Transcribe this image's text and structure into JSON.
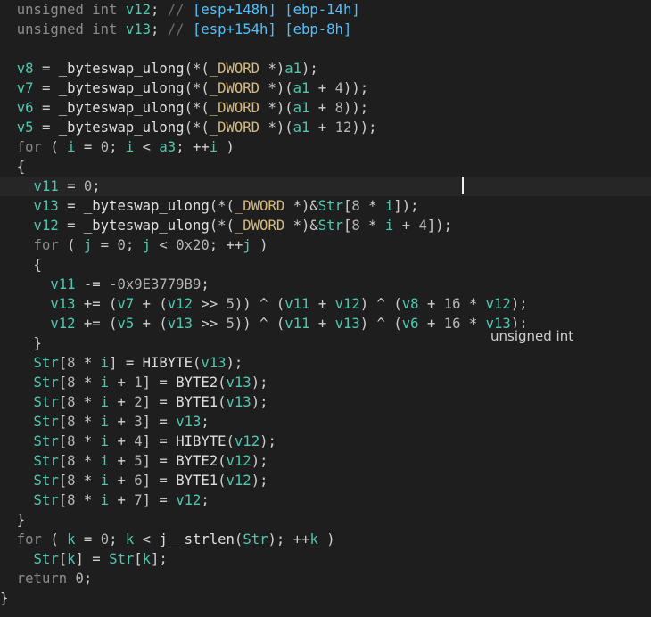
{
  "editor": {
    "lines": [
      [
        {
          "c": "kw",
          "t": "  unsigned int "
        },
        {
          "c": "var",
          "t": "v12"
        },
        {
          "c": "op",
          "t": "; "
        },
        {
          "c": "cm",
          "t": "// "
        },
        {
          "c": "cma",
          "t": "[esp+148h] [ebp-14h]"
        }
      ],
      [
        {
          "c": "kw",
          "t": "  unsigned int "
        },
        {
          "c": "var",
          "t": "v13"
        },
        {
          "c": "op",
          "t": "; "
        },
        {
          "c": "cm",
          "t": "// "
        },
        {
          "c": "cma",
          "t": "[esp+154h] [ebp-8h]"
        }
      ],
      [],
      [
        {
          "c": "var",
          "t": "  v8"
        },
        {
          "c": "op",
          "t": " = "
        },
        {
          "c": "fn",
          "t": "_byteswap_ulong"
        },
        {
          "c": "op",
          "t": "(*("
        },
        {
          "c": "ty",
          "t": "_DWORD"
        },
        {
          "c": "op",
          "t": " *)"
        },
        {
          "c": "var",
          "t": "a1"
        },
        {
          "c": "op",
          "t": ");"
        }
      ],
      [
        {
          "c": "var",
          "t": "  v7"
        },
        {
          "c": "op",
          "t": " = "
        },
        {
          "c": "fn",
          "t": "_byteswap_ulong"
        },
        {
          "c": "op",
          "t": "(*("
        },
        {
          "c": "ty",
          "t": "_DWORD"
        },
        {
          "c": "op",
          "t": " *)("
        },
        {
          "c": "var",
          "t": "a1"
        },
        {
          "c": "op",
          "t": " + "
        },
        {
          "c": "num",
          "t": "4"
        },
        {
          "c": "op",
          "t": "));"
        }
      ],
      [
        {
          "c": "var",
          "t": "  v6"
        },
        {
          "c": "op",
          "t": " = "
        },
        {
          "c": "fn",
          "t": "_byteswap_ulong"
        },
        {
          "c": "op",
          "t": "(*("
        },
        {
          "c": "ty",
          "t": "_DWORD"
        },
        {
          "c": "op",
          "t": " *)("
        },
        {
          "c": "var",
          "t": "a1"
        },
        {
          "c": "op",
          "t": " + "
        },
        {
          "c": "num",
          "t": "8"
        },
        {
          "c": "op",
          "t": "));"
        }
      ],
      [
        {
          "c": "var",
          "t": "  v5"
        },
        {
          "c": "op",
          "t": " = "
        },
        {
          "c": "fn",
          "t": "_byteswap_ulong"
        },
        {
          "c": "op",
          "t": "(*("
        },
        {
          "c": "ty",
          "t": "_DWORD"
        },
        {
          "c": "op",
          "t": " *)("
        },
        {
          "c": "var",
          "t": "a1"
        },
        {
          "c": "op",
          "t": " + "
        },
        {
          "c": "num",
          "t": "12"
        },
        {
          "c": "op",
          "t": "));"
        }
      ],
      [
        {
          "c": "kw",
          "t": "  for"
        },
        {
          "c": "op",
          "t": " ( "
        },
        {
          "c": "var",
          "t": "i"
        },
        {
          "c": "op",
          "t": " = "
        },
        {
          "c": "num",
          "t": "0"
        },
        {
          "c": "op",
          "t": "; "
        },
        {
          "c": "var",
          "t": "i"
        },
        {
          "c": "op",
          "t": " < "
        },
        {
          "c": "var",
          "t": "a3"
        },
        {
          "c": "op",
          "t": "; ++"
        },
        {
          "c": "var",
          "t": "i"
        },
        {
          "c": "op",
          "t": " )"
        }
      ],
      [
        {
          "c": "op",
          "t": "  {"
        }
      ],
      [
        {
          "c": "var",
          "t": "    v11"
        },
        {
          "c": "op",
          "t": " = "
        },
        {
          "c": "num",
          "t": "0"
        },
        {
          "c": "op",
          "t": ";"
        }
      ],
      [
        {
          "c": "var",
          "t": "    v13"
        },
        {
          "c": "op",
          "t": " = "
        },
        {
          "c": "fn",
          "t": "_byteswap_ulong"
        },
        {
          "c": "op",
          "t": "(*("
        },
        {
          "c": "ty",
          "t": "_DWORD"
        },
        {
          "c": "op",
          "t": " *)&"
        },
        {
          "c": "var",
          "t": "Str"
        },
        {
          "c": "op",
          "t": "["
        },
        {
          "c": "num",
          "t": "8"
        },
        {
          "c": "op",
          "t": " * "
        },
        {
          "c": "var",
          "t": "i"
        },
        {
          "c": "op",
          "t": "]);"
        }
      ],
      [
        {
          "c": "var",
          "t": "    v12"
        },
        {
          "c": "op",
          "t": " = "
        },
        {
          "c": "fn",
          "t": "_byteswap_ulong"
        },
        {
          "c": "op",
          "t": "(*("
        },
        {
          "c": "ty",
          "t": "_DWORD"
        },
        {
          "c": "op",
          "t": " *)&"
        },
        {
          "c": "var",
          "t": "Str"
        },
        {
          "c": "op",
          "t": "["
        },
        {
          "c": "num",
          "t": "8"
        },
        {
          "c": "op",
          "t": " * "
        },
        {
          "c": "var",
          "t": "i"
        },
        {
          "c": "op",
          "t": " + "
        },
        {
          "c": "num",
          "t": "4"
        },
        {
          "c": "op",
          "t": "]);"
        }
      ],
      [
        {
          "c": "kw",
          "t": "    for"
        },
        {
          "c": "op",
          "t": " ( "
        },
        {
          "c": "var",
          "t": "j"
        },
        {
          "c": "op",
          "t": " = "
        },
        {
          "c": "num",
          "t": "0"
        },
        {
          "c": "op",
          "t": "; "
        },
        {
          "c": "var",
          "t": "j"
        },
        {
          "c": "op",
          "t": " < "
        },
        {
          "c": "num",
          "t": "0x20"
        },
        {
          "c": "op",
          "t": "; ++"
        },
        {
          "c": "var",
          "t": "j"
        },
        {
          "c": "op",
          "t": " )"
        }
      ],
      [
        {
          "c": "op",
          "t": "    {"
        }
      ],
      [
        {
          "c": "var",
          "t": "      v11"
        },
        {
          "c": "op",
          "t": " -= "
        },
        {
          "c": "num",
          "t": "-0x9E3779B9"
        },
        {
          "c": "op",
          "t": ";"
        }
      ],
      [
        {
          "c": "var",
          "t": "      v13"
        },
        {
          "c": "op",
          "t": " += ("
        },
        {
          "c": "var",
          "t": "v7"
        },
        {
          "c": "op",
          "t": " + ("
        },
        {
          "c": "var",
          "t": "v12"
        },
        {
          "c": "op",
          "t": " >> "
        },
        {
          "c": "num",
          "t": "5"
        },
        {
          "c": "op",
          "t": ")) ^ ("
        },
        {
          "c": "var",
          "t": "v11"
        },
        {
          "c": "op",
          "t": " + "
        },
        {
          "c": "var",
          "t": "v12"
        },
        {
          "c": "op",
          "t": ") ^ ("
        },
        {
          "c": "var",
          "t": "v8"
        },
        {
          "c": "op",
          "t": " + "
        },
        {
          "c": "num",
          "t": "16"
        },
        {
          "c": "op",
          "t": " * "
        },
        {
          "c": "var",
          "t": "v12"
        },
        {
          "c": "op",
          "t": ");"
        }
      ],
      [
        {
          "c": "var",
          "t": "      v12"
        },
        {
          "c": "op",
          "t": " += ("
        },
        {
          "c": "var",
          "t": "v5"
        },
        {
          "c": "op",
          "t": " + ("
        },
        {
          "c": "var",
          "t": "v13"
        },
        {
          "c": "op",
          "t": " >> "
        },
        {
          "c": "num",
          "t": "5"
        },
        {
          "c": "op",
          "t": ")) ^ ("
        },
        {
          "c": "var",
          "t": "v11"
        },
        {
          "c": "op",
          "t": " + "
        },
        {
          "c": "var",
          "t": "v13"
        },
        {
          "c": "op",
          "t": ") ^ ("
        },
        {
          "c": "var",
          "t": "v6"
        },
        {
          "c": "op",
          "t": " + "
        },
        {
          "c": "num",
          "t": "16"
        },
        {
          "c": "op",
          "t": " * "
        },
        {
          "c": "var",
          "t": "v13"
        },
        {
          "c": "op",
          "t": ");"
        }
      ],
      [
        {
          "c": "op",
          "t": "    }"
        }
      ],
      [
        {
          "c": "var",
          "t": "    Str"
        },
        {
          "c": "op",
          "t": "["
        },
        {
          "c": "num",
          "t": "8"
        },
        {
          "c": "op",
          "t": " * "
        },
        {
          "c": "var",
          "t": "i"
        },
        {
          "c": "op",
          "t": "] = "
        },
        {
          "c": "fn",
          "t": "HIBYTE"
        },
        {
          "c": "op",
          "t": "("
        },
        {
          "c": "var",
          "t": "v13"
        },
        {
          "c": "op",
          "t": ");"
        }
      ],
      [
        {
          "c": "var",
          "t": "    Str"
        },
        {
          "c": "op",
          "t": "["
        },
        {
          "c": "num",
          "t": "8"
        },
        {
          "c": "op",
          "t": " * "
        },
        {
          "c": "var",
          "t": "i"
        },
        {
          "c": "op",
          "t": " + "
        },
        {
          "c": "num",
          "t": "1"
        },
        {
          "c": "op",
          "t": "] = "
        },
        {
          "c": "fn",
          "t": "BYTE2"
        },
        {
          "c": "op",
          "t": "("
        },
        {
          "c": "var",
          "t": "v13"
        },
        {
          "c": "op",
          "t": ");"
        }
      ],
      [
        {
          "c": "var",
          "t": "    Str"
        },
        {
          "c": "op",
          "t": "["
        },
        {
          "c": "num",
          "t": "8"
        },
        {
          "c": "op",
          "t": " * "
        },
        {
          "c": "var",
          "t": "i"
        },
        {
          "c": "op",
          "t": " + "
        },
        {
          "c": "num",
          "t": "2"
        },
        {
          "c": "op",
          "t": "] = "
        },
        {
          "c": "fn",
          "t": "BYTE1"
        },
        {
          "c": "op",
          "t": "("
        },
        {
          "c": "var",
          "t": "v13"
        },
        {
          "c": "op",
          "t": ");"
        }
      ],
      [
        {
          "c": "var",
          "t": "    Str"
        },
        {
          "c": "op",
          "t": "["
        },
        {
          "c": "num",
          "t": "8"
        },
        {
          "c": "op",
          "t": " * "
        },
        {
          "c": "var",
          "t": "i"
        },
        {
          "c": "op",
          "t": " + "
        },
        {
          "c": "num",
          "t": "3"
        },
        {
          "c": "op",
          "t": "] = "
        },
        {
          "c": "var",
          "t": "v13"
        },
        {
          "c": "op",
          "t": ";"
        }
      ],
      [
        {
          "c": "var",
          "t": "    Str"
        },
        {
          "c": "op",
          "t": "["
        },
        {
          "c": "num",
          "t": "8"
        },
        {
          "c": "op",
          "t": " * "
        },
        {
          "c": "var",
          "t": "i"
        },
        {
          "c": "op",
          "t": " + "
        },
        {
          "c": "num",
          "t": "4"
        },
        {
          "c": "op",
          "t": "] = "
        },
        {
          "c": "fn",
          "t": "HIBYTE"
        },
        {
          "c": "op",
          "t": "("
        },
        {
          "c": "var",
          "t": "v12"
        },
        {
          "c": "op",
          "t": ");"
        }
      ],
      [
        {
          "c": "var",
          "t": "    Str"
        },
        {
          "c": "op",
          "t": "["
        },
        {
          "c": "num",
          "t": "8"
        },
        {
          "c": "op",
          "t": " * "
        },
        {
          "c": "var",
          "t": "i"
        },
        {
          "c": "op",
          "t": " + "
        },
        {
          "c": "num",
          "t": "5"
        },
        {
          "c": "op",
          "t": "] = "
        },
        {
          "c": "fn",
          "t": "BYTE2"
        },
        {
          "c": "op",
          "t": "("
        },
        {
          "c": "var",
          "t": "v12"
        },
        {
          "c": "op",
          "t": ");"
        }
      ],
      [
        {
          "c": "var",
          "t": "    Str"
        },
        {
          "c": "op",
          "t": "["
        },
        {
          "c": "num",
          "t": "8"
        },
        {
          "c": "op",
          "t": " * "
        },
        {
          "c": "var",
          "t": "i"
        },
        {
          "c": "op",
          "t": " + "
        },
        {
          "c": "num",
          "t": "6"
        },
        {
          "c": "op",
          "t": "] = "
        },
        {
          "c": "fn",
          "t": "BYTE1"
        },
        {
          "c": "op",
          "t": "("
        },
        {
          "c": "var",
          "t": "v12"
        },
        {
          "c": "op",
          "t": ");"
        }
      ],
      [
        {
          "c": "var",
          "t": "    Str"
        },
        {
          "c": "op",
          "t": "["
        },
        {
          "c": "num",
          "t": "8"
        },
        {
          "c": "op",
          "t": " * "
        },
        {
          "c": "var",
          "t": "i"
        },
        {
          "c": "op",
          "t": " + "
        },
        {
          "c": "num",
          "t": "7"
        },
        {
          "c": "op",
          "t": "] = "
        },
        {
          "c": "var",
          "t": "v12"
        },
        {
          "c": "op",
          "t": ";"
        }
      ],
      [
        {
          "c": "op",
          "t": "  }"
        }
      ],
      [
        {
          "c": "kw",
          "t": "  for"
        },
        {
          "c": "op",
          "t": " ( "
        },
        {
          "c": "var",
          "t": "k"
        },
        {
          "c": "op",
          "t": " = "
        },
        {
          "c": "num",
          "t": "0"
        },
        {
          "c": "op",
          "t": "; "
        },
        {
          "c": "var",
          "t": "k"
        },
        {
          "c": "op",
          "t": " < "
        },
        {
          "c": "fn",
          "t": "j__strlen"
        },
        {
          "c": "op",
          "t": "("
        },
        {
          "c": "var",
          "t": "Str"
        },
        {
          "c": "op",
          "t": "); ++"
        },
        {
          "c": "var",
          "t": "k"
        },
        {
          "c": "op",
          "t": " )"
        }
      ],
      [
        {
          "c": "var",
          "t": "    Str"
        },
        {
          "c": "op",
          "t": "["
        },
        {
          "c": "var",
          "t": "k"
        },
        {
          "c": "op",
          "t": "] = "
        },
        {
          "c": "var",
          "t": "Str"
        },
        {
          "c": "op",
          "t": "["
        },
        {
          "c": "var",
          "t": "k"
        },
        {
          "c": "op",
          "t": "];"
        }
      ],
      [
        {
          "c": "kw",
          "t": "  return "
        },
        {
          "c": "num",
          "t": "0"
        },
        {
          "c": "op",
          "t": ";"
        }
      ],
      [
        {
          "c": "op",
          "t": "}"
        }
      ]
    ],
    "current_line_index": 9,
    "tooltip": "unsigned int"
  },
  "colors": {
    "background": "#1e1e1e",
    "variable": "#4ec9b0",
    "type": "#d7ba7d",
    "keyword": "#8c8c8c",
    "comment_address": "#4fc1ff"
  }
}
